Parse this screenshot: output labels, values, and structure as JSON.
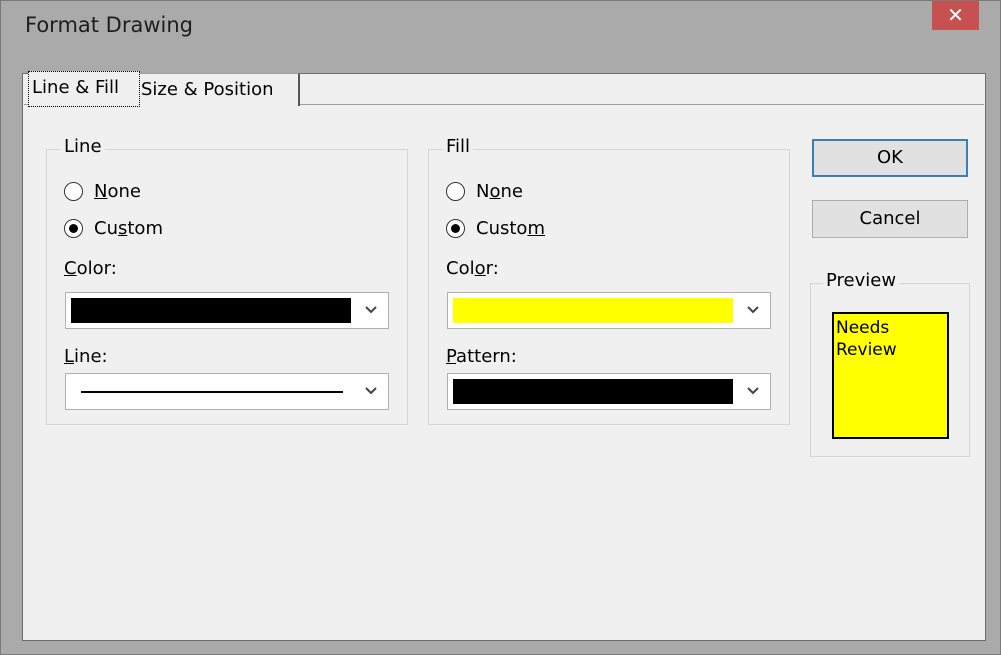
{
  "window": {
    "title": "Format Drawing",
    "close_label": "✕"
  },
  "tabs": [
    {
      "label": "Line & Fill"
    },
    {
      "label": "Size & Position"
    }
  ],
  "line_group": {
    "title": "Line",
    "radio_none": {
      "prefix": "",
      "accel": "N",
      "suffix": "one"
    },
    "radio_custom": {
      "prefix": "Cu",
      "accel": "s",
      "suffix": "tom"
    },
    "color_label": {
      "prefix": "",
      "accel": "C",
      "suffix": "olor:"
    },
    "color_value": "#000000",
    "line_label": {
      "prefix": "",
      "accel": "L",
      "suffix": "ine:"
    }
  },
  "fill_group": {
    "title": "Fill",
    "radio_none": {
      "prefix": "N",
      "accel": "o",
      "suffix": "ne"
    },
    "radio_custom": {
      "prefix": "Custo",
      "accel": "m",
      "suffix": ""
    },
    "color_label": {
      "prefix": "Col",
      "accel": "o",
      "suffix": "r:"
    },
    "color_value": "#ffff00",
    "pattern_label": {
      "prefix": "",
      "accel": "P",
      "suffix": "attern:"
    },
    "pattern_value": "#000000"
  },
  "buttons": {
    "ok": "OK",
    "cancel": "Cancel"
  },
  "preview": {
    "title": "Preview",
    "text_line1": "Needs",
    "text_line2": "Review",
    "fill_color": "#ffff00"
  }
}
